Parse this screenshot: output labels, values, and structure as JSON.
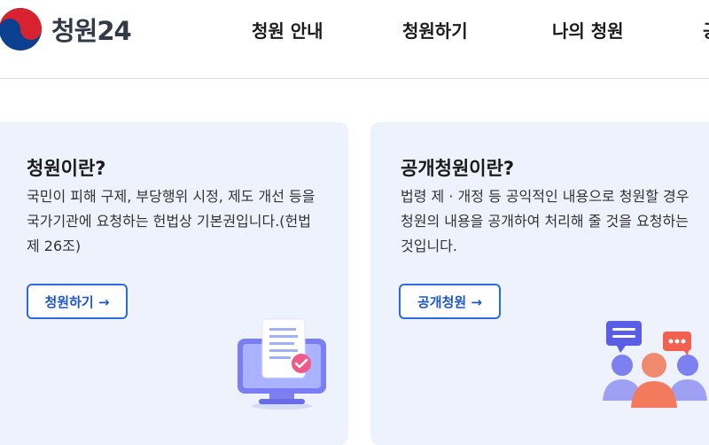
{
  "header": {
    "logo_text": "청원24",
    "nav": [
      {
        "label": "청원 안내"
      },
      {
        "label": "청원하기"
      },
      {
        "label": "나의 청원"
      },
      {
        "label": "공"
      }
    ]
  },
  "cards": [
    {
      "title": "청원이란?",
      "description": "국민이 피해 구제, 부당행위 시정, 제도 개선 등을 국가기관에 요청하는 헌법상 기본권입니다.(헌법 제 26조)",
      "button_label": "청원하기 →"
    },
    {
      "title": "공개청원이란?",
      "description": "법령 제 · 개정 등 공익적인 내용으로 청원할 경우 청원의 내용을 공개하여 처리해 줄 것을 요청하는 것입니다.",
      "button_label": "공개청원 →"
    }
  ],
  "colors": {
    "card_background": "#eef2fc",
    "button_border": "#2a6be0",
    "logo_red": "#d8222f",
    "logo_blue": "#0b3f8f"
  },
  "icons": [
    "taeguk-logo-icon",
    "monitor-document-icon",
    "group-chat-icon"
  ]
}
